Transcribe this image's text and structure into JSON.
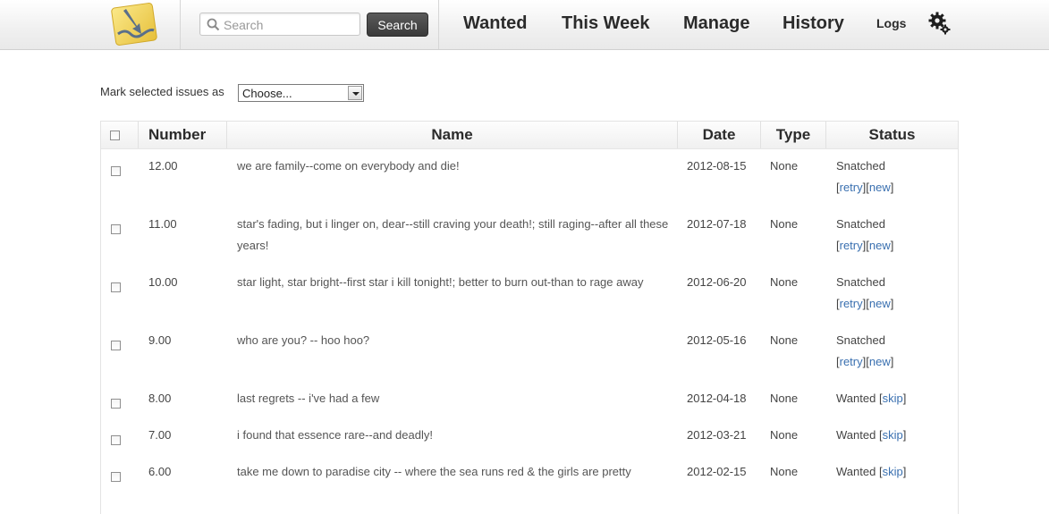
{
  "header": {
    "search_placeholder": "Search",
    "search_button": "Search",
    "nav": {
      "wanted": "Wanted",
      "this_week": "This Week",
      "manage": "Manage",
      "history": "History",
      "logs": "Logs"
    }
  },
  "toolbar": {
    "mark_label": "Mark selected issues as",
    "select_value": "Choose..."
  },
  "table": {
    "columns": [
      "Number",
      "Name",
      "Date",
      "Type",
      "Status"
    ],
    "rows": [
      {
        "number": "12.00",
        "name": "we are family--come on everybody and die!",
        "date": "2012-08-15",
        "type": "None",
        "status": "Snatched",
        "actions": [
          "retry",
          "new"
        ]
      },
      {
        "number": "11.00",
        "name": "star's fading, but i linger on, dear--still craving your death!; still raging--after all these years!",
        "date": "2012-07-18",
        "type": "None",
        "status": "Snatched",
        "actions": [
          "retry",
          "new"
        ]
      },
      {
        "number": "10.00",
        "name": "star light, star bright--first star i kill tonight!; better to burn out-than to rage away",
        "date": "2012-06-20",
        "type": "None",
        "status": "Snatched",
        "actions": [
          "retry",
          "new"
        ]
      },
      {
        "number": "9.00",
        "name": "who are you? -- hoo hoo?",
        "date": "2012-05-16",
        "type": "None",
        "status": "Snatched",
        "actions": [
          "retry",
          "new"
        ]
      },
      {
        "number": "8.00",
        "name": "last regrets -- i've had a few",
        "date": "2012-04-18",
        "type": "None",
        "status": "Wanted",
        "actions": [
          "skip"
        ]
      },
      {
        "number": "7.00",
        "name": "i found that essence rare--and deadly!",
        "date": "2012-03-21",
        "type": "None",
        "status": "Wanted",
        "actions": [
          "skip"
        ]
      },
      {
        "number": "6.00",
        "name": "take me down to paradise city -- where the sea runs red & the girls are pretty",
        "date": "2012-02-15",
        "type": "None",
        "status": "Wanted",
        "actions": [
          "skip"
        ]
      }
    ]
  },
  "icons": {
    "logo": "app-logo",
    "search": "magnifier-icon",
    "settings": "gear-icon"
  },
  "colors": {
    "link": "#3a70b0",
    "search_button_bg": "#444444",
    "logo_yellow": "#f2d65c"
  }
}
